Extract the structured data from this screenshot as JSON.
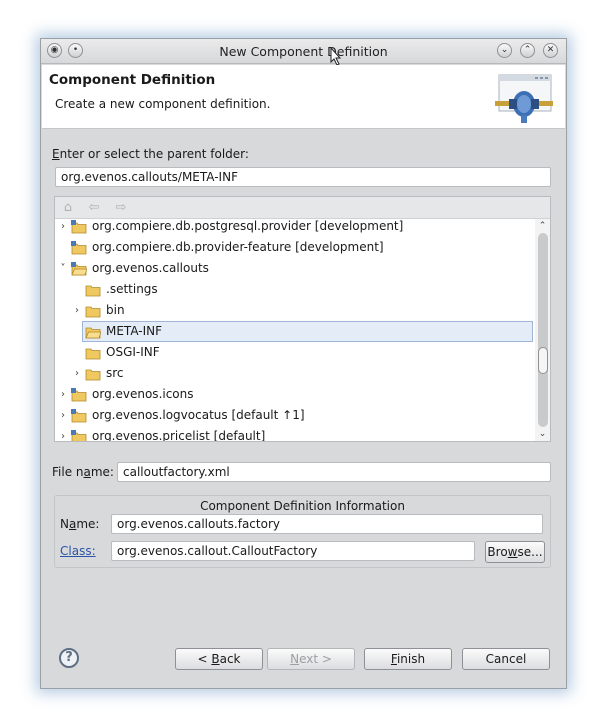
{
  "window": {
    "title": "New Component Definition"
  },
  "header": {
    "title": "Component Definition",
    "description": "Create a new component definition."
  },
  "parent_folder": {
    "label_mnemonic": "E",
    "label_rest": "nter or select the parent folder:",
    "value": "org.evenos.callouts/META-INF"
  },
  "tree": {
    "rows": [
      {
        "label": "org.compiere.db.postgresql.provider [development]",
        "type": "project",
        "toggle": "collapsed",
        "depth": 0
      },
      {
        "label": "org.compiere.db.provider-feature [development]",
        "type": "project",
        "toggle": "none",
        "depth": 0
      },
      {
        "label": "org.evenos.callouts",
        "type": "project-open",
        "toggle": "expanded",
        "depth": 0
      },
      {
        "label": ".settings",
        "type": "folder",
        "toggle": "none",
        "depth": 1
      },
      {
        "label": "bin",
        "type": "folder",
        "toggle": "collapsed",
        "depth": 1
      },
      {
        "label": "META-INF",
        "type": "folder-open",
        "toggle": "none",
        "depth": 1,
        "selected": true
      },
      {
        "label": "OSGI-INF",
        "type": "folder",
        "toggle": "none",
        "depth": 1
      },
      {
        "label": "src",
        "type": "folder",
        "toggle": "collapsed",
        "depth": 1
      },
      {
        "label": "org.evenos.icons",
        "type": "project",
        "toggle": "collapsed",
        "depth": 0
      },
      {
        "label": "org.evenos.logvocatus [default ↑1]",
        "type": "project",
        "toggle": "collapsed",
        "depth": 0
      },
      {
        "label": "org.evenos.pricelist [default]",
        "type": "project",
        "toggle": "collapsed",
        "depth": 0
      }
    ]
  },
  "file_name": {
    "label_pre": "File n",
    "label_mnemonic": "a",
    "label_post": "me:",
    "value": "calloutfactory.xml"
  },
  "info_group": {
    "title": "Component Definition Information",
    "name_label_pre": "N",
    "name_label_mnemonic": "a",
    "name_label_post": "me:",
    "name_value": "org.evenos.callouts.factory",
    "class_label": "Class:",
    "class_value": "org.evenos.callout.CalloutFactory",
    "browse_pre": "Bro",
    "browse_mnemonic": "w",
    "browse_post": "se..."
  },
  "buttons": {
    "back_pre": "< ",
    "back_mnemonic": "B",
    "back_post": "ack",
    "next_pre": "",
    "next_mnemonic": "N",
    "next_post": "ext >",
    "finish_pre": "",
    "finish_mnemonic": "F",
    "finish_post": "inish",
    "cancel": "Cancel",
    "help": "?"
  },
  "colors": {
    "selection_bg": "#e3ecf7",
    "link": "#2b55a8",
    "folder": "#f0c860"
  }
}
